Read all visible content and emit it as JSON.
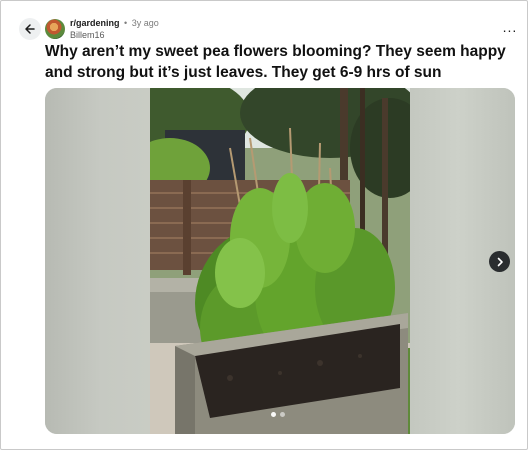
{
  "post": {
    "subreddit": "r/gardening",
    "separator": "•",
    "age": "3y ago",
    "author": "Billem16",
    "title": "Why aren’t my sweet pea flowers blooming? They seem happy and strong but it’s just leaves. They get 6-9 hrs of sun",
    "more_label": "...",
    "back_icon": "arrow-left-icon",
    "next_icon": "chevron-right-icon"
  },
  "carousel": {
    "total_images": 2,
    "current_index": 1
  },
  "colors": {
    "button_bg": "#eef0f1",
    "next_button_bg": "#2a2d2f",
    "text": "#1c1c1c",
    "muted": "#7c7c7c"
  }
}
